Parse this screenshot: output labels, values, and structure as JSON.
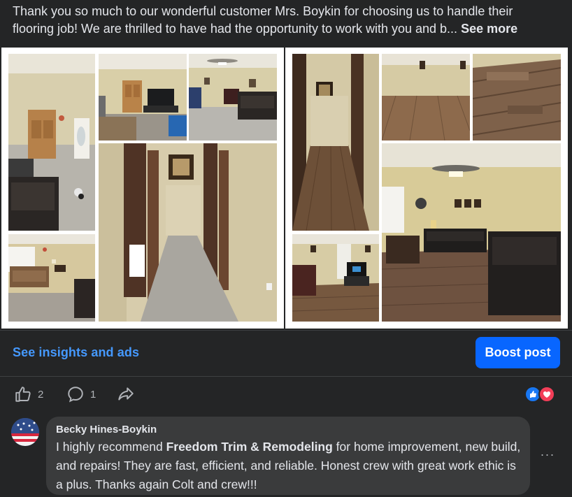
{
  "post": {
    "caption_line1": "Thank you so much to our wonderful customer Mrs. Boykin for choosing us to handle their",
    "caption_line2": "flooring job! We are thrilled to have had the opportunity to work with you and b...",
    "see_more": "See more"
  },
  "photos": {
    "left_collage": [
      {
        "name": "living-room-armoire-photo"
      },
      {
        "name": "living-room-tv-photo"
      },
      {
        "name": "living-room-sofa-photo"
      },
      {
        "name": "hallway-carpet-photo"
      },
      {
        "name": "living-room-window-photo"
      }
    ],
    "right_collage": [
      {
        "name": "hallway-wood-floor-photo"
      },
      {
        "name": "empty-room-wood-floor-photo"
      },
      {
        "name": "wood-floor-closeup-photo"
      },
      {
        "name": "living-room-wood-floor-photo"
      },
      {
        "name": "living-room-tv-wood-floor-photo"
      }
    ]
  },
  "insights": {
    "link_label": "See insights and ads",
    "boost_label": "Boost post"
  },
  "actions": {
    "like_count": "2",
    "comment_count": "1"
  },
  "reactions": {
    "icons": [
      "like-reaction-icon",
      "love-reaction-icon"
    ],
    "colors": {
      "like": "#1877f2",
      "love": "#f33e58"
    }
  },
  "comment": {
    "author": "Becky Hines-Boykin",
    "text_before": "I highly recommend ",
    "business": "Freedom Trim & Remodeling",
    "text_after": " for home improvement, new build, and repairs! They are fast, efficient, and reliable. Honest crew with great work ethic is a plus. Thanks again Colt and crew!!!",
    "more_label": "···"
  },
  "colors": {
    "background": "#242526",
    "accent": "#0866ff",
    "link": "#4599ff",
    "bubble": "#3a3b3c"
  }
}
